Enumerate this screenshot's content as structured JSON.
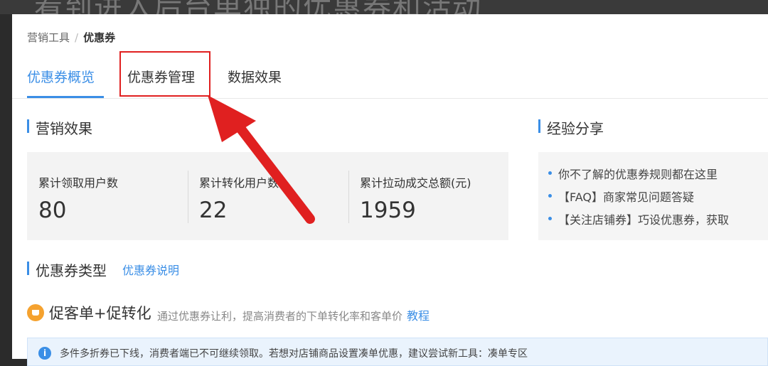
{
  "overlay": {
    "caption_fragment": "看到进入后台单独的优惠券和活动"
  },
  "breadcrumb": {
    "parent": "营销工具",
    "separator": "/",
    "current": "优惠券"
  },
  "tabs": [
    {
      "label": "优惠券概览",
      "active": true
    },
    {
      "label": "优惠券管理",
      "active": false
    },
    {
      "label": "数据效果",
      "active": false
    }
  ],
  "marketing": {
    "title": "营销效果",
    "stats": [
      {
        "label": "累计领取用户数",
        "value": "80"
      },
      {
        "label": "累计转化用户数",
        "value": "22"
      },
      {
        "label": "累计拉动成交总额(元)",
        "value": "1959"
      }
    ]
  },
  "experience": {
    "title": "经验分享",
    "items": [
      "你不了解的优惠券规则都在这里",
      "【FAQ】商家常见问题答疑",
      "【关注店铺券】巧设优惠券，获取"
    ]
  },
  "coupon_types": {
    "title": "优惠券类型",
    "link": "优惠券说明"
  },
  "promo": {
    "title": "促客单+促转化",
    "description": "通过优惠券让利，提高消费者的下单转化率和客单价",
    "tutorial_link": "教程"
  },
  "notice": {
    "icon": "i",
    "text": "多件多折券已下线，消费者端已不可继续领取。若想对店铺商品设置凑单优惠，建议尝试新工具：凑单专区"
  },
  "colors": {
    "accent": "#3a8ee6",
    "annotation_red": "#e02020",
    "promo_orange": "#f5a22f"
  }
}
